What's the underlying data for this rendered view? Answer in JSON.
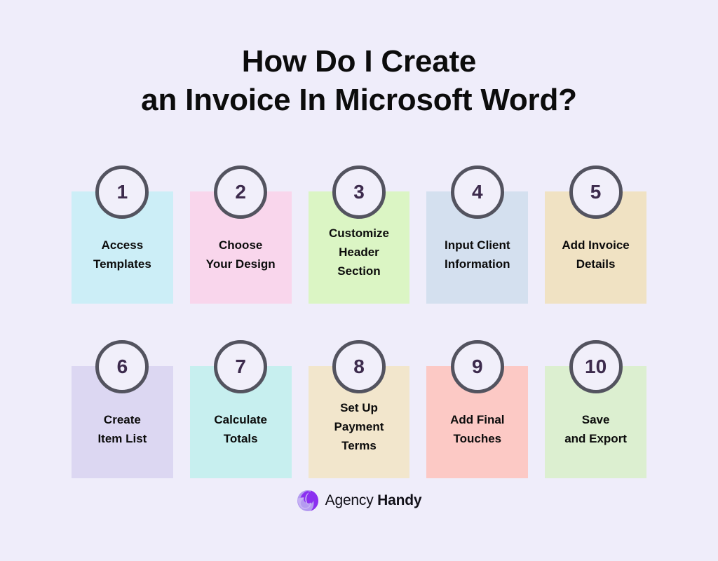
{
  "theme": {
    "background": "#EFEDFA",
    "title_color": "#0C0C0C",
    "badge_fill": "#F1EFFA",
    "badge_border": "#53535F",
    "badge_number_color": "#3D2B4D",
    "label_color": "#0C0C0C",
    "logo_purple_light": "#B49BF0",
    "logo_purple_dark": "#8B30F0"
  },
  "header": {
    "title_line_1": "How Do I Create",
    "title_line_2": "an Invoice In Microsoft Word?"
  },
  "steps": [
    {
      "number": "1",
      "label": "Access\nTemplates",
      "color": "#CCEEF7",
      "lines": 2
    },
    {
      "number": "2",
      "label": "Choose\nYour Design",
      "color": "#F9D6EC",
      "lines": 2
    },
    {
      "number": "3",
      "label": "Customize\nHeader\nSection",
      "color": "#DBF5C4",
      "lines": 3
    },
    {
      "number": "4",
      "label": "Input Client\nInformation",
      "color": "#D4E0EF",
      "lines": 2
    },
    {
      "number": "5",
      "label": "Add Invoice\nDetails",
      "color": "#F0E2C3",
      "lines": 2
    },
    {
      "number": "6",
      "label": "Create\nItem List",
      "color": "#DCD7F2",
      "lines": 2
    },
    {
      "number": "7",
      "label": "Calculate\nTotals",
      "color": "#C7EFEF",
      "lines": 2
    },
    {
      "number": "8",
      "label": "Set Up\nPayment\nTerms",
      "color": "#F2E6CC",
      "lines": 3
    },
    {
      "number": "9",
      "label": "Add Final\nTouches",
      "color": "#FCC9C5",
      "lines": 2
    },
    {
      "number": "10",
      "label": "Save\nand Export",
      "color": "#DCEFD0",
      "lines": 2
    }
  ],
  "footer": {
    "logo_icon": "agency-handy-swirl-icon",
    "brand_light": "Agency",
    "brand_bold": "Handy"
  }
}
